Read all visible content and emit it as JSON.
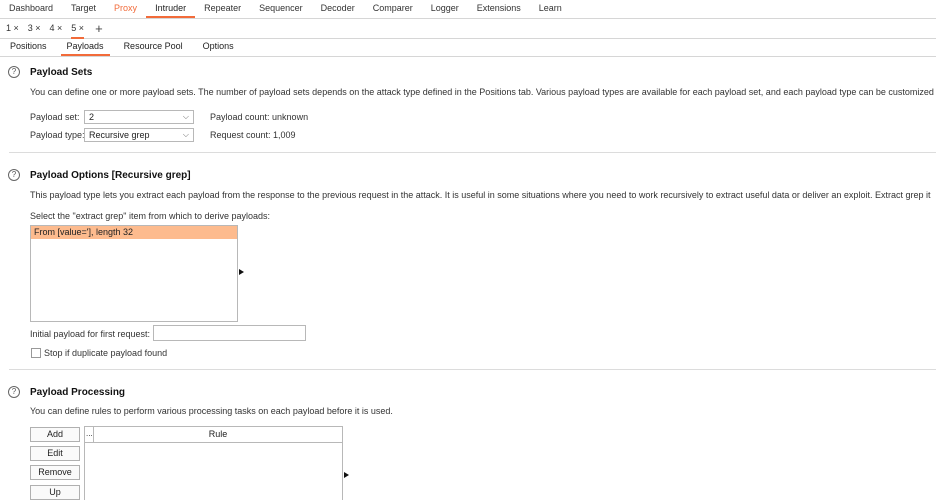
{
  "top_nav": [
    "Dashboard",
    "Target",
    "Proxy",
    "Intruder",
    "Repeater",
    "Sequencer",
    "Decoder",
    "Comparer",
    "Logger",
    "Extensions",
    "Learn"
  ],
  "attack_tabs": [
    "1 ×",
    "3 ×",
    "4 ×",
    "5 ×"
  ],
  "add_tab_label": "+",
  "sub_tabs": [
    "Positions",
    "Payloads",
    "Resource Pool",
    "Options"
  ],
  "payload_sets": {
    "title": "Payload Sets",
    "description": "You can define one or more payload sets. The number of payload sets depends on the attack type defined in the Positions tab. Various payload types are available for each payload set, and each payload type can be customized",
    "payload_set_label": "Payload set:",
    "payload_set_value": "2",
    "payload_type_label": "Payload type:",
    "payload_type_value": "Recursive grep",
    "payload_count": "Payload count: unknown",
    "request_count": "Request count: 1,009"
  },
  "payload_options": {
    "title": "Payload Options [Recursive grep]",
    "description": "This payload type lets you extract each payload from the response to the previous request in the attack. It is useful in some situations where you need to work recursively to extract useful data or deliver an exploit. Extract grep it",
    "select_label": "Select the \"extract grep\" item from which to derive payloads:",
    "grep_item": "From [value='], length 32",
    "initial_payload_label": "Initial payload for first request:",
    "initial_payload_value": "",
    "stop_duplicate_label": "Stop if duplicate payload found"
  },
  "payload_processing": {
    "title": "Payload Processing",
    "description": "You can define rules to perform various processing tasks on each payload before it is used.",
    "buttons": [
      "Add",
      "Edit",
      "Remove",
      "Up"
    ],
    "col_enabled": "...",
    "col_rule": "Rule"
  },
  "help_glyph": "?",
  "chevron_glyph": "⌵",
  "colors": {
    "accent": "#f26b3a",
    "selection": "#fdbb8e"
  }
}
